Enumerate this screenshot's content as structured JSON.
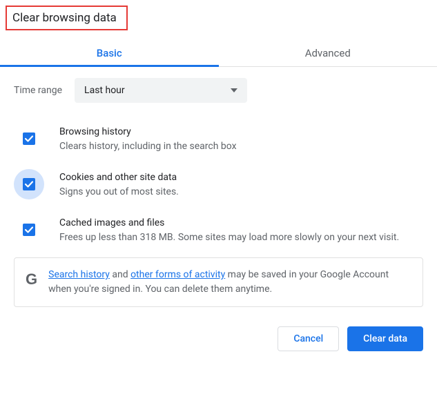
{
  "title": "Clear browsing data",
  "tabs": {
    "basic": "Basic",
    "advanced": "Advanced"
  },
  "time": {
    "label": "Time range",
    "selected": "Last hour"
  },
  "options": {
    "browsing": {
      "title": "Browsing history",
      "desc": "Clears history, including in the search box"
    },
    "cookies": {
      "title": "Cookies and other site data",
      "desc": "Signs you out of most sites."
    },
    "cache": {
      "title": "Cached images and files",
      "desc": "Frees up less than 318 MB. Some sites may load more slowly on your next visit."
    }
  },
  "info": {
    "link1": "Search history",
    "mid1": " and ",
    "link2": "other forms of activity",
    "rest": " may be saved in your Google Account when you're signed in. You can delete them anytime."
  },
  "buttons": {
    "cancel": "Cancel",
    "clear": "Clear data"
  }
}
